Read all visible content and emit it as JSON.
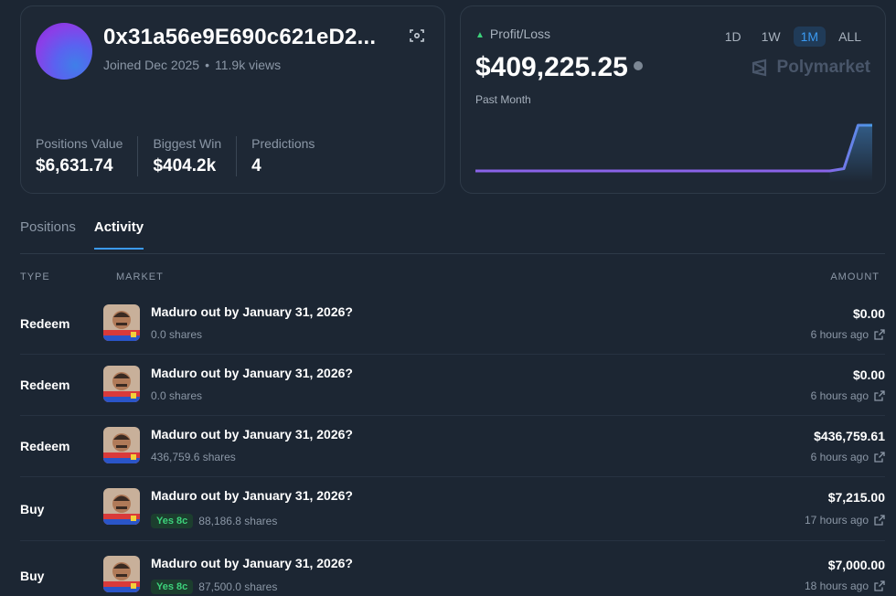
{
  "profile": {
    "address": "0x31a56e9E690c621eD2...",
    "joined": "Joined Dec 2025",
    "views": "11.9k views",
    "stats": [
      {
        "label": "Positions Value",
        "value": "$6,631.74"
      },
      {
        "label": "Biggest Win",
        "value": "$404.2k"
      },
      {
        "label": "Predictions",
        "value": "4"
      }
    ]
  },
  "pnl": {
    "label": "Profit/Loss",
    "value": "$409,225.25",
    "period": "Past Month",
    "ranges": [
      "1D",
      "1W",
      "1M",
      "ALL"
    ],
    "active_range": "1M",
    "brand": "Polymarket",
    "trend": [
      0,
      0,
      0,
      0,
      0,
      0,
      0,
      0,
      0,
      0,
      0,
      0,
      0,
      0,
      0,
      0,
      0,
      0,
      0,
      0,
      0,
      0,
      0,
      0,
      0,
      0,
      0.05,
      1,
      1
    ],
    "colors": {
      "line": "#8a63e8",
      "line_end": "#4a9ae8",
      "up": "#3dd27b",
      "active": "#3b9af2"
    }
  },
  "tabs": [
    "Positions",
    "Activity"
  ],
  "active_tab": "Activity",
  "table": {
    "headers": {
      "type": "TYPE",
      "market": "MARKET",
      "amount": "AMOUNT"
    },
    "rows": [
      {
        "type": "Redeem",
        "market": "Maduro out by January 31, 2026?",
        "badge": "",
        "shares": "0.0 shares",
        "amount": "$0.00",
        "time": "6 hours ago"
      },
      {
        "type": "Redeem",
        "market": "Maduro out by January 31, 2026?",
        "badge": "",
        "shares": "0.0 shares",
        "amount": "$0.00",
        "time": "6 hours ago"
      },
      {
        "type": "Redeem",
        "market": "Maduro out by January 31, 2026?",
        "badge": "",
        "shares": "436,759.6 shares",
        "amount": "$436,759.61",
        "time": "6 hours ago"
      },
      {
        "type": "Buy",
        "market": "Maduro out by January 31, 2026?",
        "badge": "Yes 8c",
        "shares": "88,186.8 shares",
        "amount": "$7,215.00",
        "time": "17 hours ago"
      },
      {
        "type": "Buy",
        "market": "Maduro out by January 31, 2026?",
        "badge": "Yes 8c",
        "shares": "87,500.0 shares",
        "amount": "$7,000.00",
        "time": "18 hours ago"
      }
    ]
  }
}
